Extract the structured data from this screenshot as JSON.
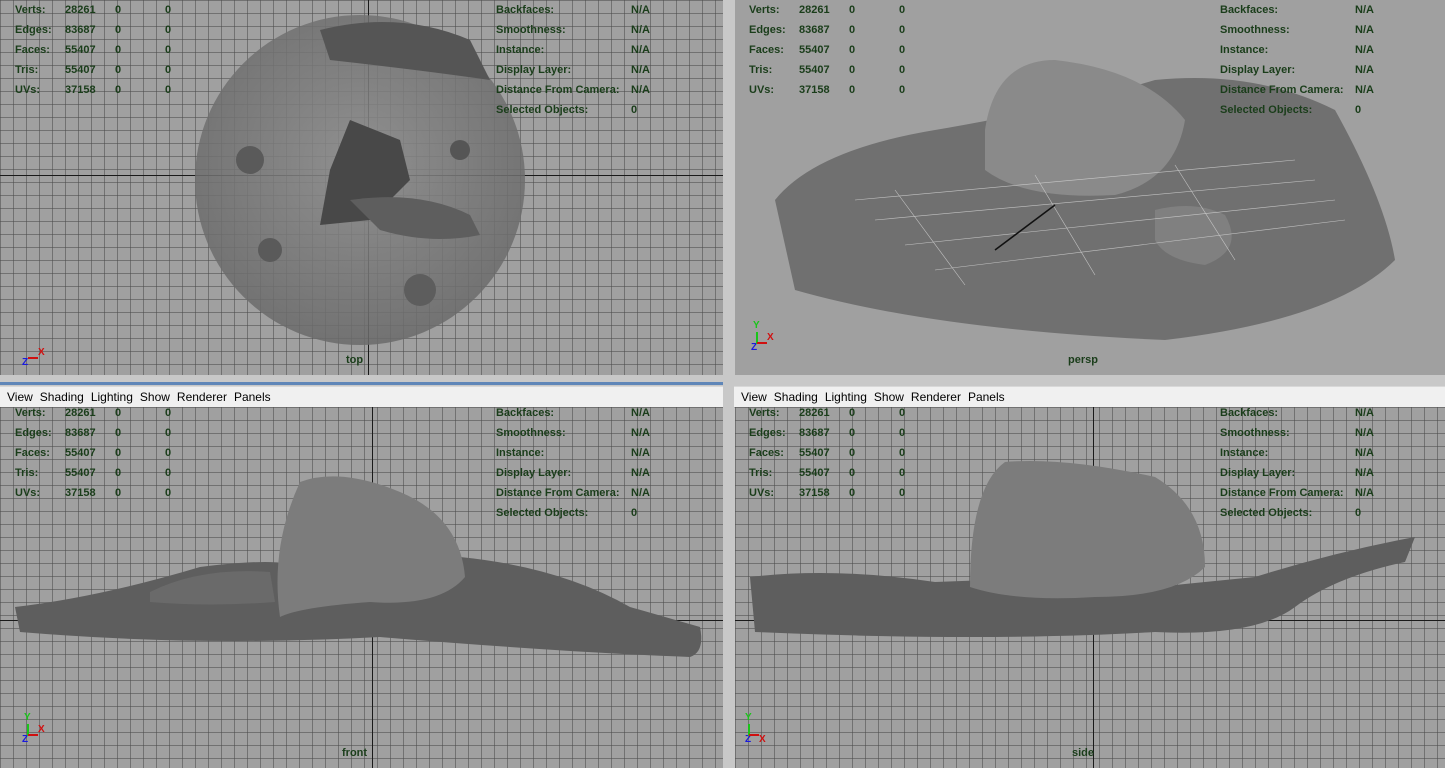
{
  "panel_menu": [
    "View",
    "Shading",
    "Lighting",
    "Show",
    "Renderer",
    "Panels"
  ],
  "hud_left": {
    "rows": [
      {
        "label": "Verts:",
        "values": [
          "28261",
          "0",
          "0"
        ]
      },
      {
        "label": "Edges:",
        "values": [
          "83687",
          "0",
          "0"
        ]
      },
      {
        "label": "Faces:",
        "values": [
          "55407",
          "0",
          "0"
        ]
      },
      {
        "label": "Tris:",
        "values": [
          "55407",
          "0",
          "0"
        ]
      },
      {
        "label": "UVs:",
        "values": [
          "37158",
          "0",
          "0"
        ]
      }
    ]
  },
  "hud_right": {
    "rows": [
      {
        "label": "Backfaces:",
        "value": "N/A"
      },
      {
        "label": "Smoothness:",
        "value": "N/A"
      },
      {
        "label": "Instance:",
        "value": "N/A"
      },
      {
        "label": "Display Layer:",
        "value": "N/A"
      },
      {
        "label": "Distance From Camera:",
        "value": "N/A"
      },
      {
        "label": "Selected Objects:",
        "value": "0"
      }
    ]
  },
  "gizmo": {
    "x": "X",
    "y": "Y",
    "z": "Z"
  },
  "viewports": {
    "top": {
      "camera": "top"
    },
    "persp": {
      "camera": "persp"
    },
    "front": {
      "camera": "front"
    },
    "side": {
      "camera": "side"
    }
  },
  "colors": {
    "hud_text": "#1a3d1a",
    "viewport_bg": "#a0a0a0",
    "mesh": "#6e6e6e",
    "menubar": "#f0f0f0"
  }
}
